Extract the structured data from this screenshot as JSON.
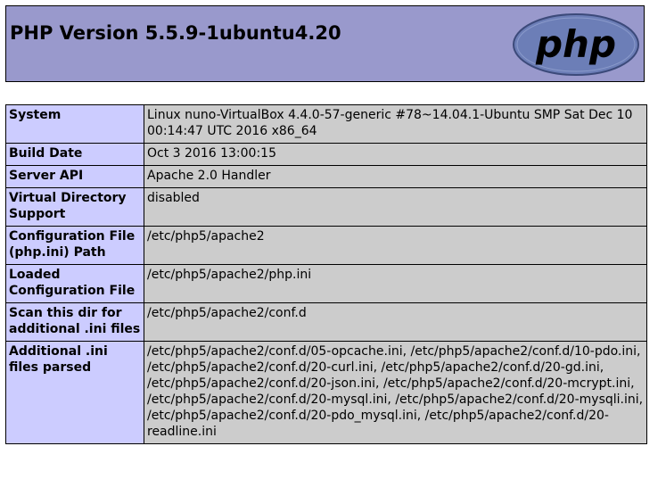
{
  "header": {
    "title": "PHP Version 5.5.9-1ubuntu4.20",
    "logo_text": "php"
  },
  "rows": [
    {
      "key": "System",
      "value": "Linux nuno-VirtualBox 4.4.0-57-generic #78~14.04.1-Ubuntu SMP Sat Dec 10 00:14:47 UTC 2016 x86_64"
    },
    {
      "key": "Build Date",
      "value": "Oct 3 2016 13:00:15"
    },
    {
      "key": "Server API",
      "value": "Apache 2.0 Handler"
    },
    {
      "key": "Virtual Directory Support",
      "value": "disabled"
    },
    {
      "key": "Configuration File (php.ini) Path",
      "value": "/etc/php5/apache2"
    },
    {
      "key": "Loaded Configuration File",
      "value": "/etc/php5/apache2/php.ini"
    },
    {
      "key": "Scan this dir for additional .ini files",
      "value": "/etc/php5/apache2/conf.d"
    },
    {
      "key": "Additional .ini files parsed",
      "value": "/etc/php5/apache2/conf.d/05-opcache.ini, /etc/php5/apache2/conf.d/10-pdo.ini, /etc/php5/apache2/conf.d/20-curl.ini, /etc/php5/apache2/conf.d/20-gd.ini, /etc/php5/apache2/conf.d/20-json.ini, /etc/php5/apache2/conf.d/20-mcrypt.ini, /etc/php5/apache2/conf.d/20-mysql.ini, /etc/php5/apache2/conf.d/20-mysqli.ini, /etc/php5/apache2/conf.d/20-pdo_mysql.ini, /etc/php5/apache2/conf.d/20-readline.ini"
    }
  ]
}
